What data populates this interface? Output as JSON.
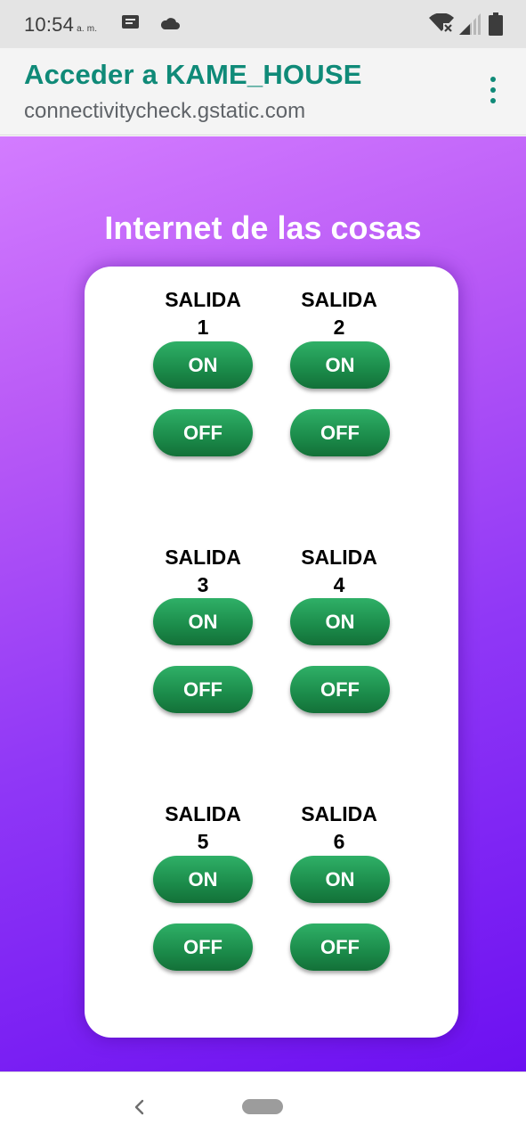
{
  "status_bar": {
    "time": "10:54",
    "ampm": "a. m.",
    "icons": [
      "message-icon",
      "cloud-icon",
      "wifi-off-icon",
      "signal-icon",
      "battery-icon"
    ]
  },
  "browser": {
    "title": "Acceder a KAME_HOUSE",
    "url": "connectivitycheck.gstatic.com",
    "menu_icon": "more-vert-icon",
    "accent_color": "#0f8a78"
  },
  "page": {
    "heading": "Internet de las cosas",
    "outputs": [
      {
        "line1": "SALIDA",
        "line2": "1",
        "on_label": "ON",
        "off_label": "OFF"
      },
      {
        "line1": "SALIDA",
        "line2": "2",
        "on_label": "ON",
        "off_label": "OFF"
      },
      {
        "line1": "SALIDA",
        "line2": "3",
        "on_label": "ON",
        "off_label": "OFF"
      },
      {
        "line1": "SALIDA",
        "line2": "4",
        "on_label": "ON",
        "off_label": "OFF"
      },
      {
        "line1": "SALIDA",
        "line2": "5",
        "on_label": "ON",
        "off_label": "OFF"
      },
      {
        "line1": "SALIDA",
        "line2": "6",
        "on_label": "ON",
        "off_label": "OFF"
      }
    ],
    "colors": {
      "gradient_top": "#d37cff",
      "gradient_bottom": "#6c10f1",
      "button_green": "#1b8b4a"
    }
  },
  "nav_bar": {
    "icons": [
      "back-icon",
      "home-pill-icon"
    ]
  }
}
